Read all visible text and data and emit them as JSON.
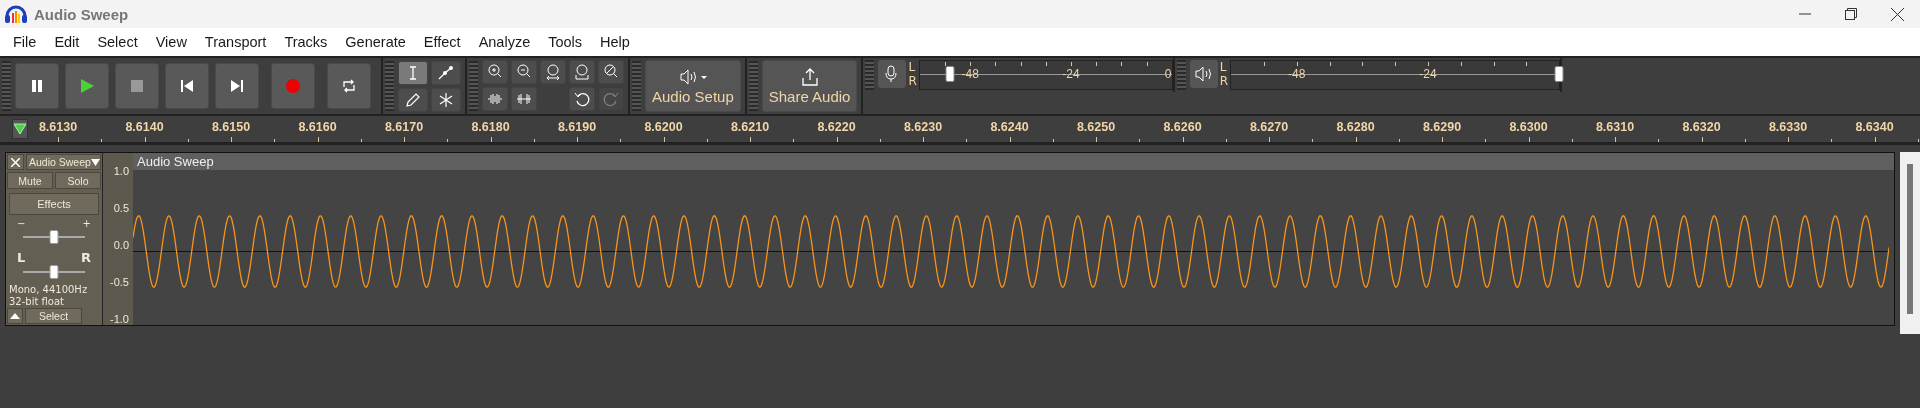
{
  "window": {
    "title": "Audio Sweep"
  },
  "menu": [
    "File",
    "Edit",
    "Select",
    "View",
    "Transport",
    "Tracks",
    "Generate",
    "Effect",
    "Analyze",
    "Tools",
    "Help"
  ],
  "transport": [
    {
      "kind": "pause"
    },
    {
      "kind": "play"
    },
    {
      "kind": "stop"
    },
    {
      "kind": "skip-start"
    },
    {
      "kind": "skip-end"
    },
    {
      "kind": "record"
    },
    {
      "kind": "loop"
    }
  ],
  "tools": [
    {
      "kind": "select",
      "selected": true
    },
    {
      "kind": "envelope",
      "selected": false
    },
    {
      "kind": "draw",
      "selected": false
    },
    {
      "kind": "multi",
      "selected": false
    }
  ],
  "edit_tools": [
    {
      "kind": "zoom-in",
      "disabled": false
    },
    {
      "kind": "zoom-out",
      "disabled": false
    },
    {
      "kind": "fit-selection",
      "disabled": false
    },
    {
      "kind": "fit-project",
      "disabled": false
    },
    {
      "kind": "zoom-toggle",
      "disabled": false
    },
    {
      "kind": "trim",
      "disabled": false
    },
    {
      "kind": "silence",
      "disabled": false
    },
    {
      "kind": "gap"
    },
    {
      "kind": "undo",
      "disabled": false
    },
    {
      "kind": "redo",
      "disabled": true
    }
  ],
  "audio_setup": {
    "label": "Audio Setup"
  },
  "share_audio": {
    "label": "Share Audio"
  },
  "meters": [
    {
      "kind": "record",
      "channels": [
        "L",
        "R"
      ],
      "scale": [
        "-48",
        "-24",
        "0"
      ],
      "level": 0.12
    },
    {
      "kind": "playback",
      "channels": [
        "L",
        "R"
      ],
      "scale": [
        "-48",
        "-24"
      ],
      "level": 1.0
    }
  ],
  "ruler": [
    "8.6130",
    "8.6140",
    "8.6150",
    "8.6160",
    "8.6170",
    "8.6180",
    "8.6190",
    "8.6200",
    "8.6210",
    "8.6220",
    "8.6230",
    "8.6240",
    "8.6250",
    "8.6260",
    "8.6270",
    "8.6280",
    "8.6290",
    "8.6300",
    "8.6310",
    "8.6320",
    "8.6330",
    "8.6340"
  ],
  "track": {
    "name": "Audio Sweep",
    "mute": "Mute",
    "solo": "Solo",
    "effects": "Effects",
    "gain": {
      "minus": "−",
      "plus": "+",
      "level": 0.5
    },
    "pan": {
      "left": "L",
      "right": "R",
      "level": 0.5
    },
    "info": [
      "Mono, 44100Hz",
      "32-bit float"
    ],
    "select": "Select",
    "clip_title": "Audio Sweep",
    "scale": [
      "1.0",
      "0.5",
      "0.0",
      "-0.5",
      "-1.0"
    ]
  }
}
